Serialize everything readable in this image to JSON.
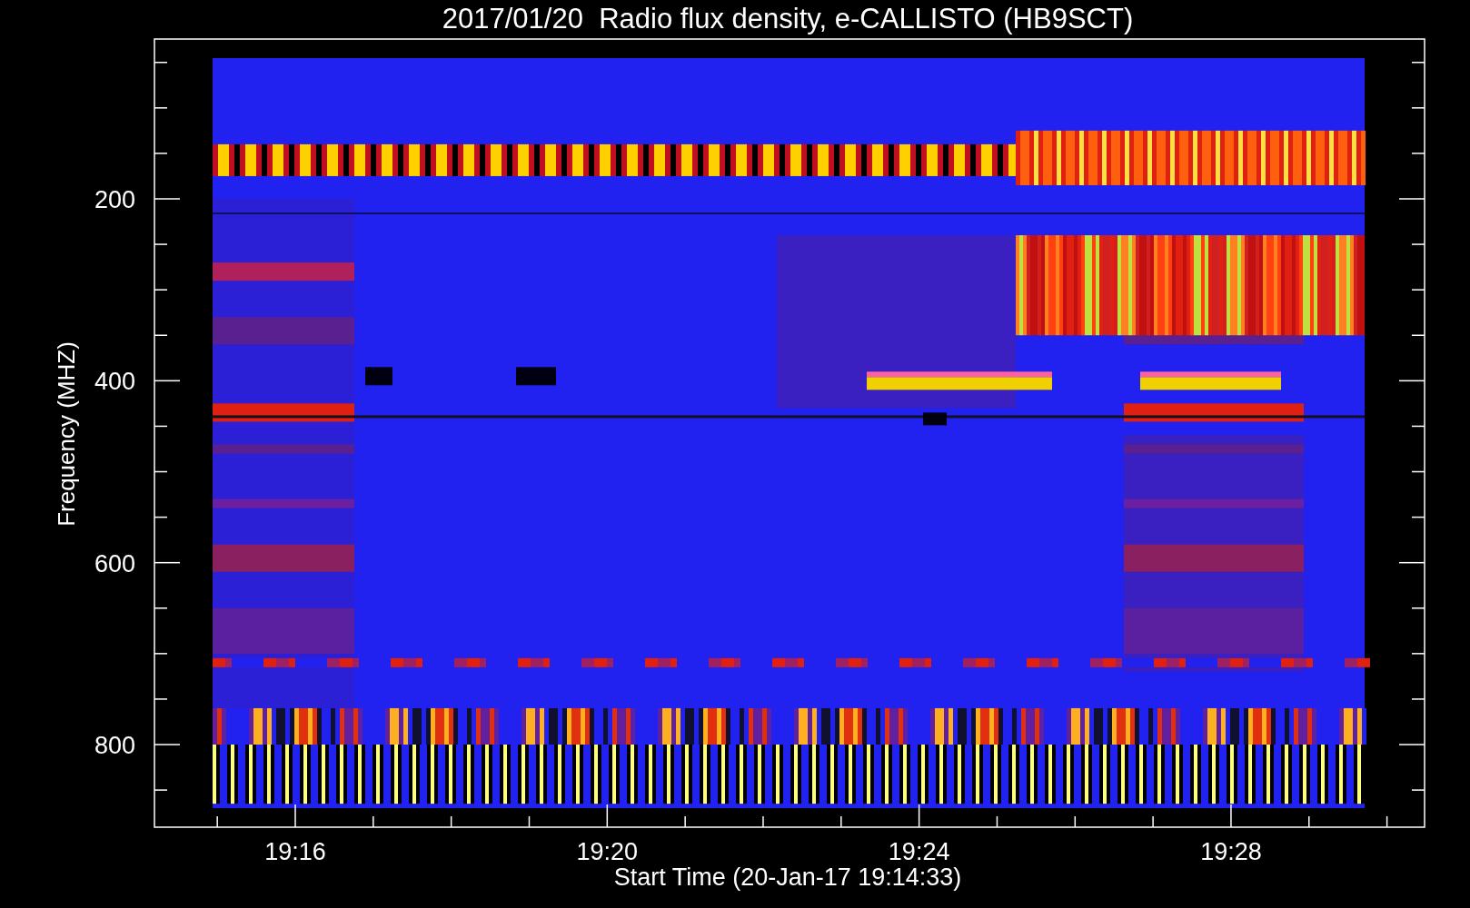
{
  "title": "2017/01/20  Radio flux density, e-CALLISTO (HB9SCT)",
  "y_axis": {
    "label": "Frequency (MHZ)",
    "ticks": [
      "200",
      "400",
      "600",
      "800"
    ]
  },
  "x_axis": {
    "label": "Start Time (20-Jan-17 19:14:33)",
    "ticks": [
      "19:16",
      "19:20",
      "19:24",
      "19:28"
    ]
  }
}
